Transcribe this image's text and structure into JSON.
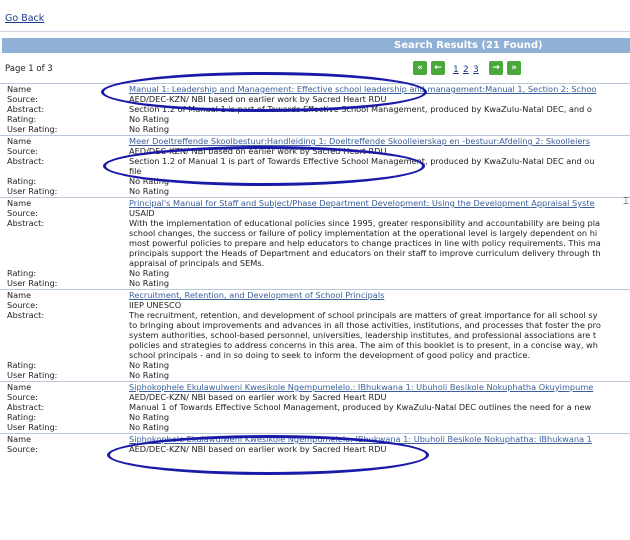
{
  "go_back": "Go Back",
  "results_header": "Search Results (21 Found)",
  "page_of": "Page 1 of 3",
  "pages": [
    "1",
    "2",
    "3"
  ],
  "labels": {
    "name": "Name",
    "source": "Source:",
    "abstract": "Abstract:",
    "rating": "Rating:",
    "user_rating": "User Rating:"
  },
  "records": [
    {
      "name": "Manual 1: Leadership and Management: Effective school leadership and management:Manual 1, Section 2: Schoo",
      "source": "AED/DEC-KZN/ NBI based on earlier work by Sacred Heart RDU",
      "abstract": [
        "Section 1.2 of Manual 1 is part of Towards Effective School Management, produced by KwaZulu-Natal DEC, and o"
      ],
      "rating": "No Rating",
      "user_rating": "No Rating"
    },
    {
      "name": "Meer Doeltreffende Skoolbestuur:Handleiding 1: Doeltreffende Skoolleierskap en -bestuur:Afdeling 2: Skoolleiers",
      "source": "AED/DEC-KZN/ NBI based on earlier work by Sacred Heart RDU",
      "abstract": [
        "Section 1.2 of Manual 1 is part of Towards Effective School Management, produced by KwaZulu-Natal DEC and ou",
        "file"
      ],
      "rating": "No Rating",
      "user_rating": "No Rating"
    },
    {
      "name": "Principal's Manual for Staff and Subject/Phase Department Development: Using the Development Appraisal Syste",
      "source": "USAID",
      "abstract": [
        "With the implementation of educational policies since 1995, greater responsibility and accountability are being pla",
        "school changes, the success or failure of policy implementation at the operational level is largely dependent on hi",
        "most powerful policies to prepare and help educators to change practices in line with policy requirements. This ma",
        "principals support the Heads of Department and educators on their staff to improve curriculum delivery through th",
        "appraisal of principals and SEMs."
      ],
      "rating": "No Rating",
      "user_rating": "No Rating"
    },
    {
      "name": "Recruitment, Retention, and Development of School Principals",
      "source": "IIEP UNESCO",
      "abstract": [
        "The recruitment, retention, and development of school principals are matters of great importance for all school sy",
        "to bringing about improvements and advances in all those activities, institutions, and processes that foster the pro",
        "system authorities, school-based personnel, universities, leadership institutes, and professional associations are t",
        "policies and strategies to address concerns in this area. The aim of this booklet is to present, in a concise way, wh",
        "school principals - and in so doing to seek to inform the development of good policy and practice."
      ],
      "rating": "No Rating",
      "user_rating": "No Rating"
    },
    {
      "name": "Siphokophele Ekulawulweni Kwesikole Ngempumelelo.: IBhukwana 1: Ubuholi Besikole Nokuphatha Okuyimpume",
      "source": "AED/DEC-KZN/ NBI based on earlier work by Sacred Heart RDU",
      "abstract": [
        "Manual 1 of Towards Effective School Management, produced by KwaZulu-Natal DEC outlines the need for a new"
      ],
      "rating": "No Rating",
      "user_rating": "No Rating"
    },
    {
      "name": "Siphokophele Ekulawulweni Kwesikole Ngempumelelo: IBhukwana 1: Ubuholi Besikole Nokuphatha: IBhukwana 1",
      "source": "AED/DEC-KZN/ NBI based on earlier work by Sacred Heart RDU",
      "abstract": [],
      "rating": "",
      "user_rating": ""
    }
  ]
}
